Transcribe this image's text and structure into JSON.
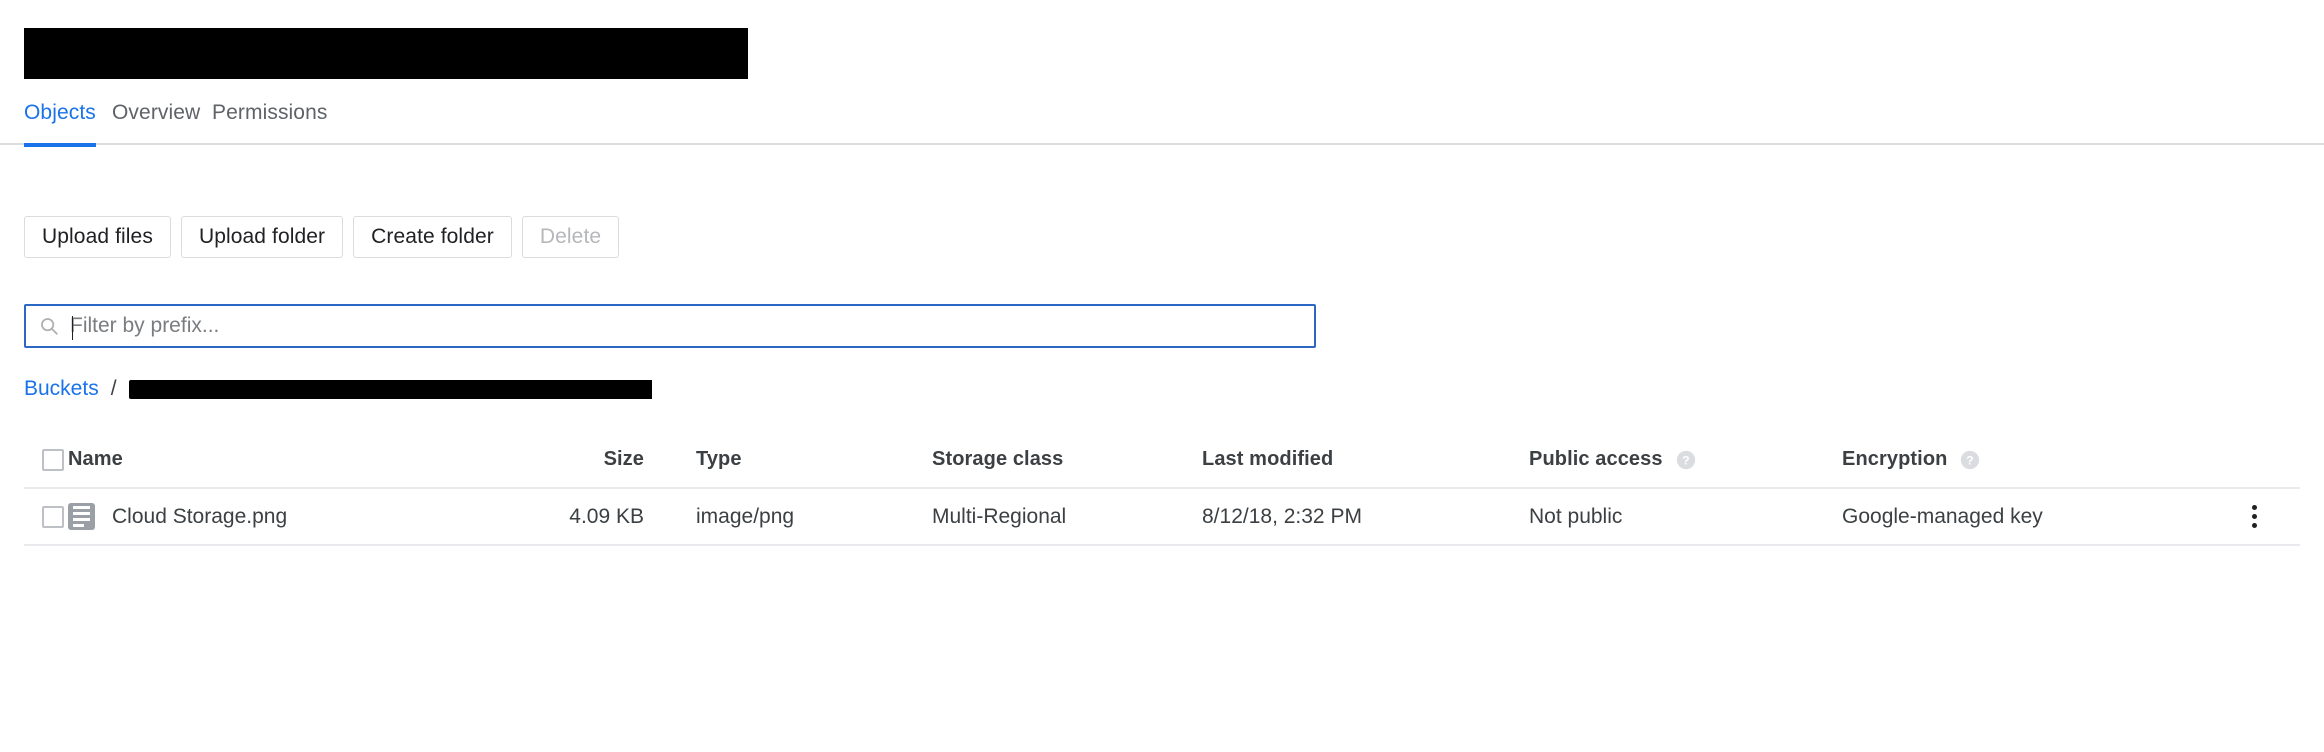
{
  "header": {
    "title_redacted": true,
    "tabs": [
      {
        "label": "Objects",
        "active": true
      },
      {
        "label": "Overview",
        "active": false
      },
      {
        "label": "Permissions",
        "active": false
      }
    ]
  },
  "toolbar": {
    "upload_files_label": "Upload files",
    "upload_folder_label": "Upload folder",
    "create_folder_label": "Create folder",
    "delete_label": "Delete"
  },
  "filter": {
    "placeholder": "Filter by prefix...",
    "value": "",
    "icon": "search-icon",
    "focused": true
  },
  "breadcrumb": {
    "root_label": "Buckets",
    "separator": "/",
    "current_redacted": true
  },
  "table": {
    "columns": [
      {
        "key": "name",
        "label": "Name",
        "help": false
      },
      {
        "key": "size",
        "label": "Size",
        "help": false
      },
      {
        "key": "type",
        "label": "Type",
        "help": false
      },
      {
        "key": "storage_class",
        "label": "Storage class",
        "help": false
      },
      {
        "key": "last_modified",
        "label": "Last modified",
        "help": false
      },
      {
        "key": "public_access",
        "label": "Public access",
        "help": true
      },
      {
        "key": "encryption",
        "label": "Encryption",
        "help": true
      }
    ],
    "rows": [
      {
        "name": "Cloud Storage.png",
        "size": "4.09 KB",
        "type": "image/png",
        "storage_class": "Multi-Regional",
        "last_modified": "8/12/18, 2:32 PM",
        "public_access": "Not public",
        "encryption": "Google-managed key",
        "icon": "file-icon",
        "selected": false
      }
    ],
    "select_all_checked": false,
    "row_menu_icon": "kebab-menu-icon",
    "help_icon": "help-icon"
  },
  "colors": {
    "accent": "#1a73e8",
    "focus_border": "#2c67c4",
    "text": "#3c4043",
    "muted": "#5f6368",
    "disabled": "#b5b7ba",
    "divider": "#e8eaed",
    "icon_grey": "#9aa0a6",
    "redaction": "#000000"
  }
}
